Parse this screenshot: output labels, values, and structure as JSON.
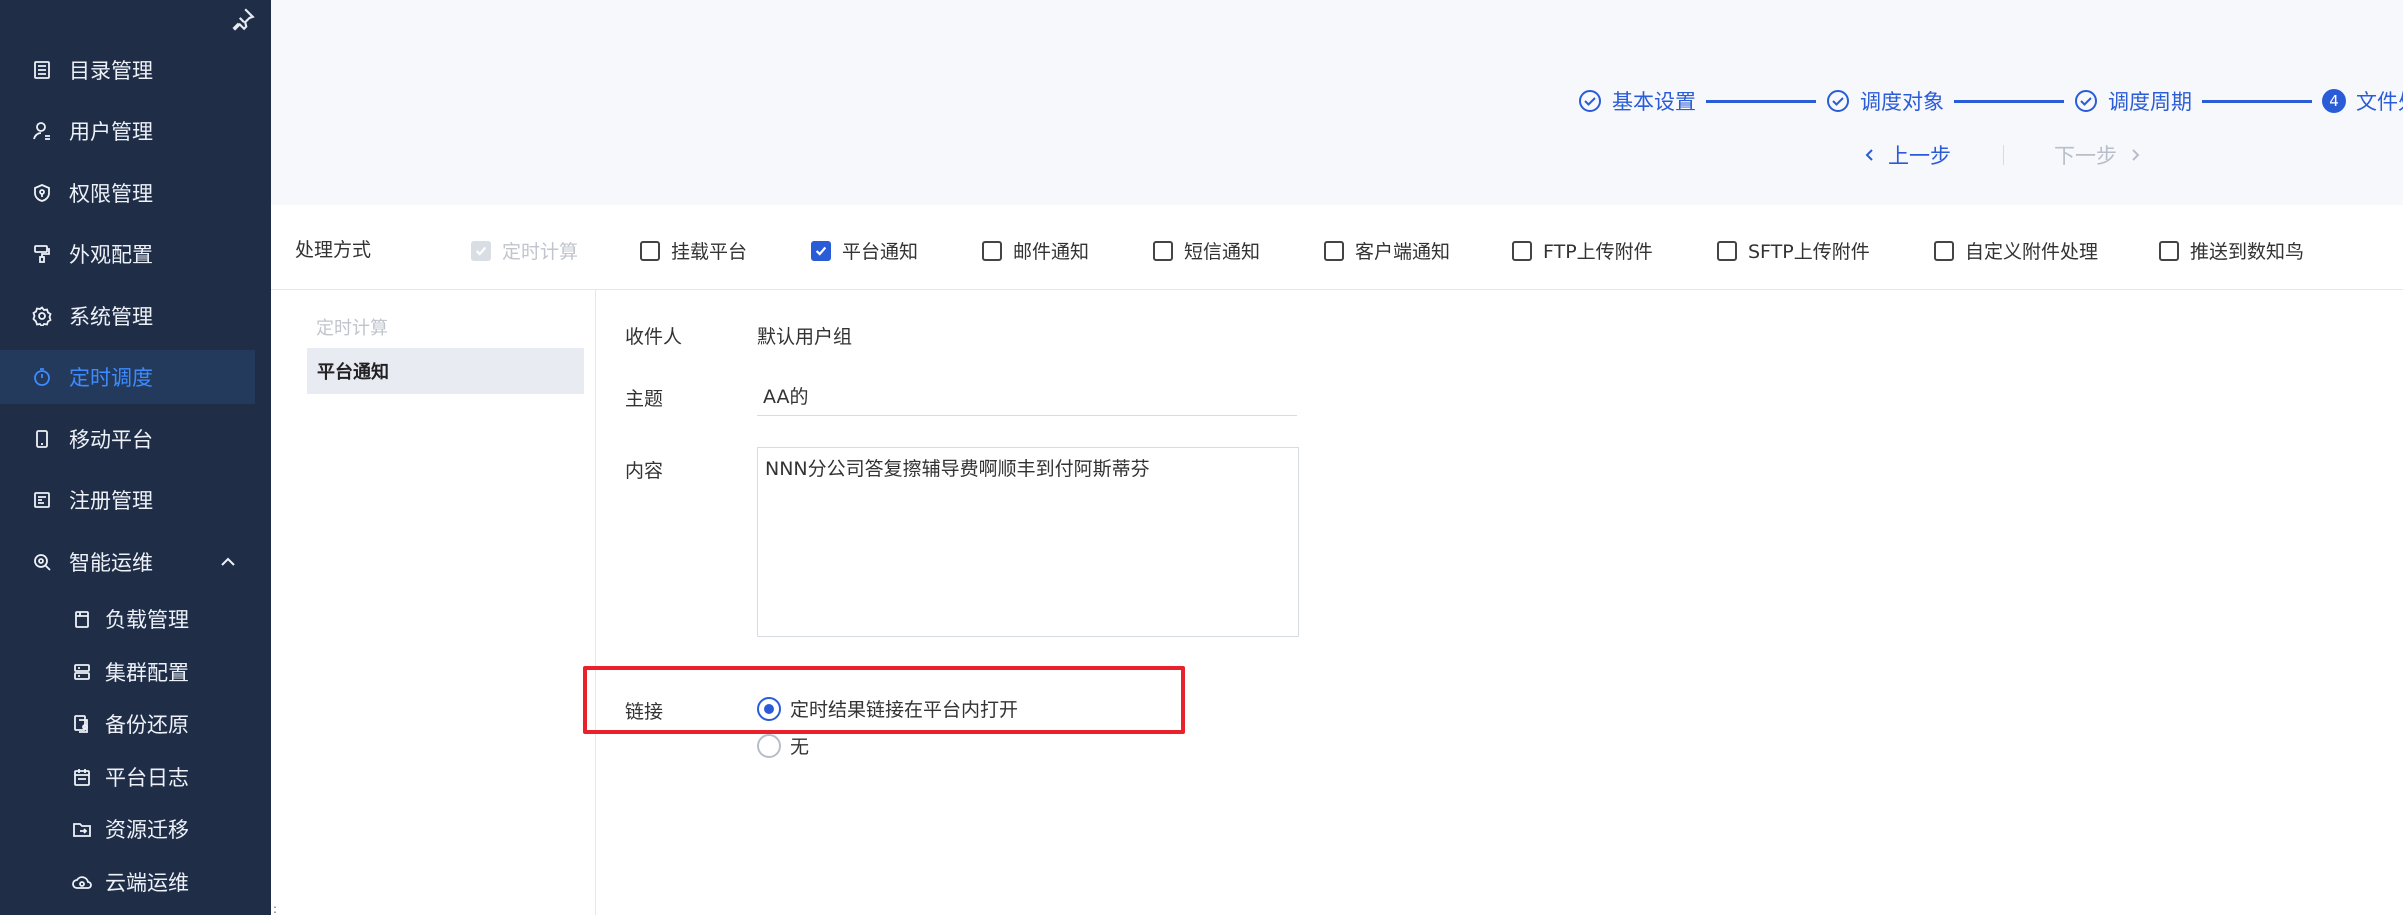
{
  "sidebar": {
    "items": [
      {
        "label": "目录管理",
        "icon": "catalog-icon"
      },
      {
        "label": "用户管理",
        "icon": "user-icon"
      },
      {
        "label": "权限管理",
        "icon": "shield-icon"
      },
      {
        "label": "外观配置",
        "icon": "brush-icon"
      },
      {
        "label": "系统管理",
        "icon": "gear-icon"
      },
      {
        "label": "定时调度",
        "icon": "timer-icon",
        "active": true
      },
      {
        "label": "移动平台",
        "icon": "phone-icon"
      },
      {
        "label": "注册管理",
        "icon": "register-icon"
      },
      {
        "label": "智能运维",
        "icon": "ops-icon",
        "expanded": true
      }
    ],
    "subitems": [
      {
        "label": "负载管理",
        "icon": "load-icon"
      },
      {
        "label": "集群配置",
        "icon": "cluster-icon"
      },
      {
        "label": "备份还原",
        "icon": "backup-icon"
      },
      {
        "label": "平台日志",
        "icon": "log-icon"
      },
      {
        "label": "资源迁移",
        "icon": "migrate-icon"
      },
      {
        "label": "云端运维",
        "icon": "cloud-icon"
      }
    ]
  },
  "steps": [
    {
      "label": "基本设置",
      "state": "done"
    },
    {
      "label": "调度对象",
      "state": "done"
    },
    {
      "label": "调度周期",
      "state": "done"
    },
    {
      "label": "文件处",
      "state": "current",
      "number": "4"
    }
  ],
  "nav": {
    "prev": "上一步",
    "next": "下一步"
  },
  "handler": {
    "label": "处理方式",
    "options": [
      {
        "label": "定时计算",
        "checked": true,
        "disabled": true
      },
      {
        "label": "挂载平台",
        "checked": false
      },
      {
        "label": "平台通知",
        "checked": true
      },
      {
        "label": "邮件通知",
        "checked": false
      },
      {
        "label": "短信通知",
        "checked": false
      },
      {
        "label": "客户端通知",
        "checked": false
      },
      {
        "label": "FTP上传附件",
        "checked": false
      },
      {
        "label": "SFTP上传附件",
        "checked": false
      },
      {
        "label": "自定义附件处理",
        "checked": false
      },
      {
        "label": "推送到数知鸟",
        "checked": false
      }
    ]
  },
  "subnav": {
    "disabled": "定时计算",
    "active": "平台通知"
  },
  "form": {
    "recipient_label": "收件人",
    "recipient_value": "默认用户组",
    "subject_label": "主题",
    "subject_value": "AA的",
    "content_label": "内容",
    "content_value": "NNN分公司答复擦辅导费啊顺丰到付阿斯蒂芬",
    "link_label": "链接",
    "link_options": [
      {
        "label": "定时结果链接在平台内打开",
        "selected": true
      },
      {
        "label": "无",
        "selected": false
      }
    ]
  },
  "colors": {
    "sidebar_bg": "#1f2d47",
    "accent": "#2a5cd7",
    "highlight": "#e8212a"
  }
}
